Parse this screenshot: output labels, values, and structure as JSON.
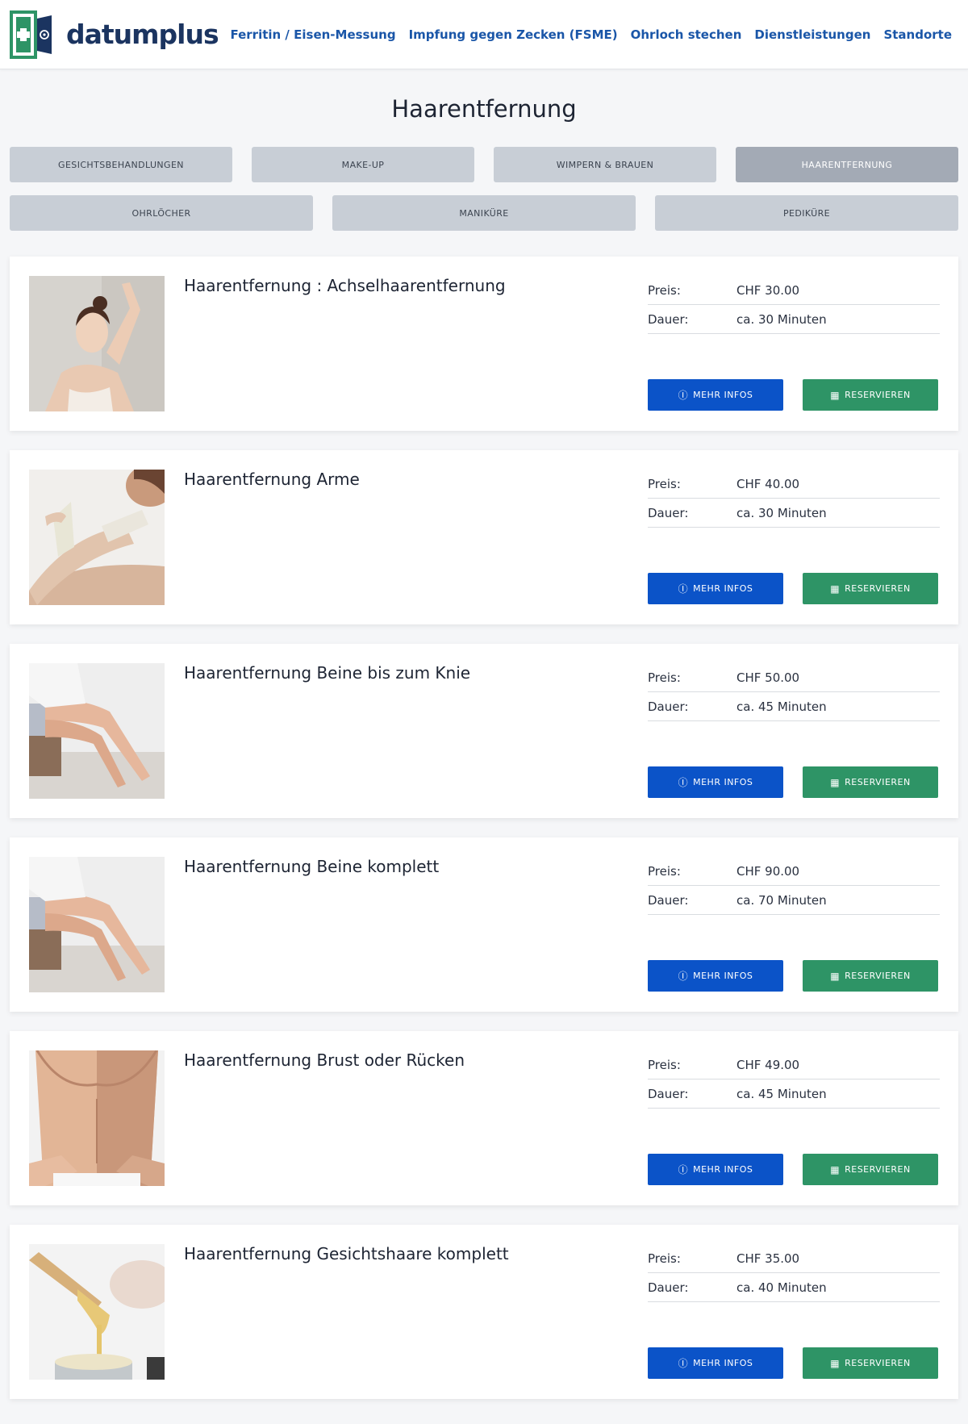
{
  "brand": {
    "name": "datumplus",
    "color_green": "#2e9466",
    "color_navy": "#1b3460"
  },
  "nav": [
    {
      "label": "Ferritin / Eisen-Messung"
    },
    {
      "label": "Impfung gegen Zecken (FSME)"
    },
    {
      "label": "Ohrloch stechen"
    },
    {
      "label": "Dienstleistungen"
    },
    {
      "label": "Standorte"
    }
  ],
  "page_title": "Haarentfernung",
  "tabs_row1": [
    {
      "label": "GESICHTSBEHANDLUNGEN"
    },
    {
      "label": "MAKE-UP"
    },
    {
      "label": "WIMPERN & BRAUEN"
    },
    {
      "label": "HAARENTFERNUNG",
      "active": true
    }
  ],
  "tabs_row2": [
    {
      "label": "OHRLÖCHER"
    },
    {
      "label": "MANIKÜRE"
    },
    {
      "label": "PEDIKÜRE"
    }
  ],
  "labels": {
    "price": "Preis:",
    "duration": "Dauer:",
    "more_info": "MEHR INFOS",
    "reserve": "RESERVIEREN"
  },
  "services": [
    {
      "title": "Haarentfernung : Achselhaarentfernung",
      "price": "CHF 30.00",
      "duration": "ca. 30 Minuten",
      "image": "woman-arm-raised"
    },
    {
      "title": "Haarentfernung Arme",
      "price": "CHF 40.00",
      "duration": "ca. 30 Minuten",
      "image": "arm-wax-strip"
    },
    {
      "title": "Haarentfernung Beine bis zum Knie",
      "price": "CHF 50.00",
      "duration": "ca. 45 Minuten",
      "image": "legs-on-bed"
    },
    {
      "title": "Haarentfernung Beine komplett",
      "price": "CHF 90.00",
      "duration": "ca. 70 Minuten",
      "image": "legs-on-bed"
    },
    {
      "title": "Haarentfernung Brust oder Rücken",
      "price": "CHF 49.00",
      "duration": "ca. 45 Minuten",
      "image": "male-torso"
    },
    {
      "title": "Haarentfernung Gesichtshaare komplett",
      "price": "CHF 35.00",
      "duration": "ca. 40 Minuten",
      "image": "wax-spatula"
    }
  ],
  "colors": {
    "info_button": "#0b53c8",
    "reserve_button": "#2e9466",
    "tab": "#c8ced6",
    "tab_active": "#a3aab5",
    "nav_link": "#1a56a8"
  }
}
